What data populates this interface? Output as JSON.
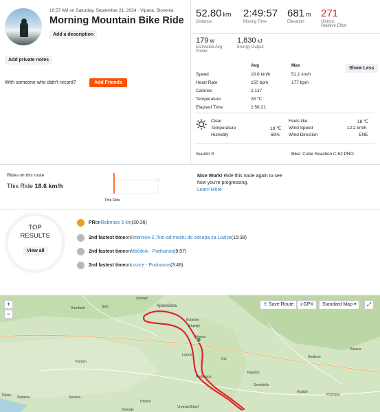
{
  "header": {
    "datetime": "10:57 AM on Saturday, September 21, 2024 · Vipava, Slovenia",
    "title": "Morning Mountain Bike Ride",
    "add_description": "Add a description",
    "add_private_notes": "Add private notes",
    "with_someone": "With someone who didn't record?",
    "add_friends": "Add Friends"
  },
  "stats": {
    "distance": {
      "value": "52.80",
      "unit": "km",
      "label": "Distance"
    },
    "moving_time": {
      "value": "2:49:57",
      "label": "Moving Time"
    },
    "elevation": {
      "value": "681",
      "unit": "m",
      "label": "Elevation"
    },
    "relative_effort": {
      "value": "271",
      "label1": "Historic",
      "label2": "Relative Effort"
    },
    "power": {
      "value": "179",
      "unit": "W",
      "label1": "Estimated Avg",
      "label2": "Power"
    },
    "energy": {
      "value": "1,830",
      "unit": "kJ",
      "label": "Energy Output"
    }
  },
  "details": {
    "avg_header": "Avg",
    "max_header": "Max",
    "show_less": "Show Less",
    "rows": [
      {
        "label": "Speed",
        "avg": "18.6 km/h",
        "max": "51.1 km/h"
      },
      {
        "label": "Heart Rate",
        "avg": "150 bpm",
        "max": "177 bpm"
      },
      {
        "label": "Calories",
        "avg": "2,137",
        "max": ""
      },
      {
        "label": "Temperature",
        "avg": "28 ℃",
        "max": ""
      },
      {
        "label": "Elapsed Time",
        "avg": "2:58:21",
        "max": ""
      }
    ]
  },
  "weather": {
    "condition": "Clear",
    "temperature_label": "Temperature",
    "temperature": "18 ℃",
    "humidity_label": "Humidity",
    "humidity": "68%",
    "feels_like_label": "Feels like",
    "feels_like": "18 ℃",
    "wind_speed_label": "Wind Speed",
    "wind_speed": "12.2 km/h",
    "wind_dir_label": "Wind Direction",
    "wind_dir": "ENE"
  },
  "device": "Suunto 9",
  "bike": "Bike: Cube Reaction C:62 PRO",
  "route": {
    "rides_label": "Rides on this route",
    "this_ride_label": "This Ride",
    "this_ride_speed": "18.6 km/h",
    "chart_label": "This Ride",
    "nice_work": "Nice Work!",
    "message": " Ride this route again to see how you're progressing.",
    "learn_more": "Learn More"
  },
  "results": {
    "title1": "TOP",
    "title2": "RESULTS",
    "view_all": "View all",
    "items": [
      {
        "prefix": "PR",
        "mid": " on ",
        "segment": "Rebrnice 5 km",
        "time": " (30:36)",
        "medal": "#e8a317"
      },
      {
        "prefix": "2nd fastest time",
        "mid": " on ",
        "segment": "Rebrnice-2,7km-od mostu do odcepa za Lozice",
        "time": " (15:38)",
        "medal": "#b8b8c0"
      },
      {
        "prefix": "2nd fastest time",
        "mid": " on ",
        "segment": "Močilnik - Podnanos",
        "time": " (9:57)",
        "medal": "#b8b8c0"
      },
      {
        "prefix": "2nd fastest time",
        "mid": " on ",
        "segment": "Lozice - Podnanos",
        "time": " (3:48)",
        "medal": "#b8b8c0"
      }
    ]
  },
  "map": {
    "zoom_in": "+",
    "zoom_out": "−",
    "save_route": "Save Route",
    "gpx": "GPX",
    "map_type": "Standard Map",
    "places": [
      "Dornberk",
      "Selo",
      "Stomaž",
      "Ajdovščina",
      "Budanje",
      "Vipava",
      "Vrhpolje",
      "Lozice",
      "Podnanos",
      "Hrašče",
      "Postojna",
      "Planina",
      "Studeno",
      "Komen",
      "Sežana",
      "Divača",
      "Vremski Britof",
      "Dutovlje",
      "Sistiana",
      "Duino",
      "Razdrto",
      "Senožeče",
      "Col"
    ]
  },
  "colors": {
    "accent": "#fc5200",
    "route_line": "#e0242a",
    "effort_red": "#d0262b",
    "link": "#2b78c2"
  }
}
